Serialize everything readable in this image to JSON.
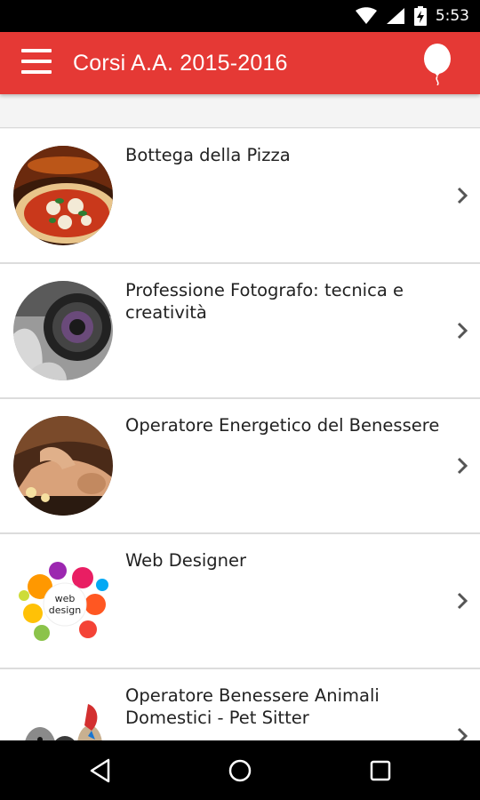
{
  "status_bar": {
    "time": "5:53",
    "icons": [
      "wifi-icon",
      "signal-icon",
      "battery-charging-icon"
    ]
  },
  "app_bar": {
    "title": "Corsi A.A. 2015-2016",
    "background_color": "#e53935",
    "menu_icon": "hamburger-menu-icon",
    "action_icon": "balloon-icon"
  },
  "courses": [
    {
      "title": "Bottega della Pizza",
      "thumbnail": "pizza-image"
    },
    {
      "title": "Professione Fotografo: tecnica e creatività",
      "thumbnail": "camera-image"
    },
    {
      "title": "Operatore Energetico del Benessere",
      "thumbnail": "massage-image"
    },
    {
      "title": "Web Designer",
      "thumbnail": "web-design-balloons-image"
    },
    {
      "title": "Operatore Benessere Animali Domestici - Pet Sitter",
      "thumbnail": "pets-image"
    }
  ],
  "thumbnail_text": {
    "web_design_line1": "web",
    "web_design_line2": "design"
  },
  "nav_bar": {
    "icons": [
      "back-icon",
      "home-icon",
      "recents-icon"
    ]
  }
}
